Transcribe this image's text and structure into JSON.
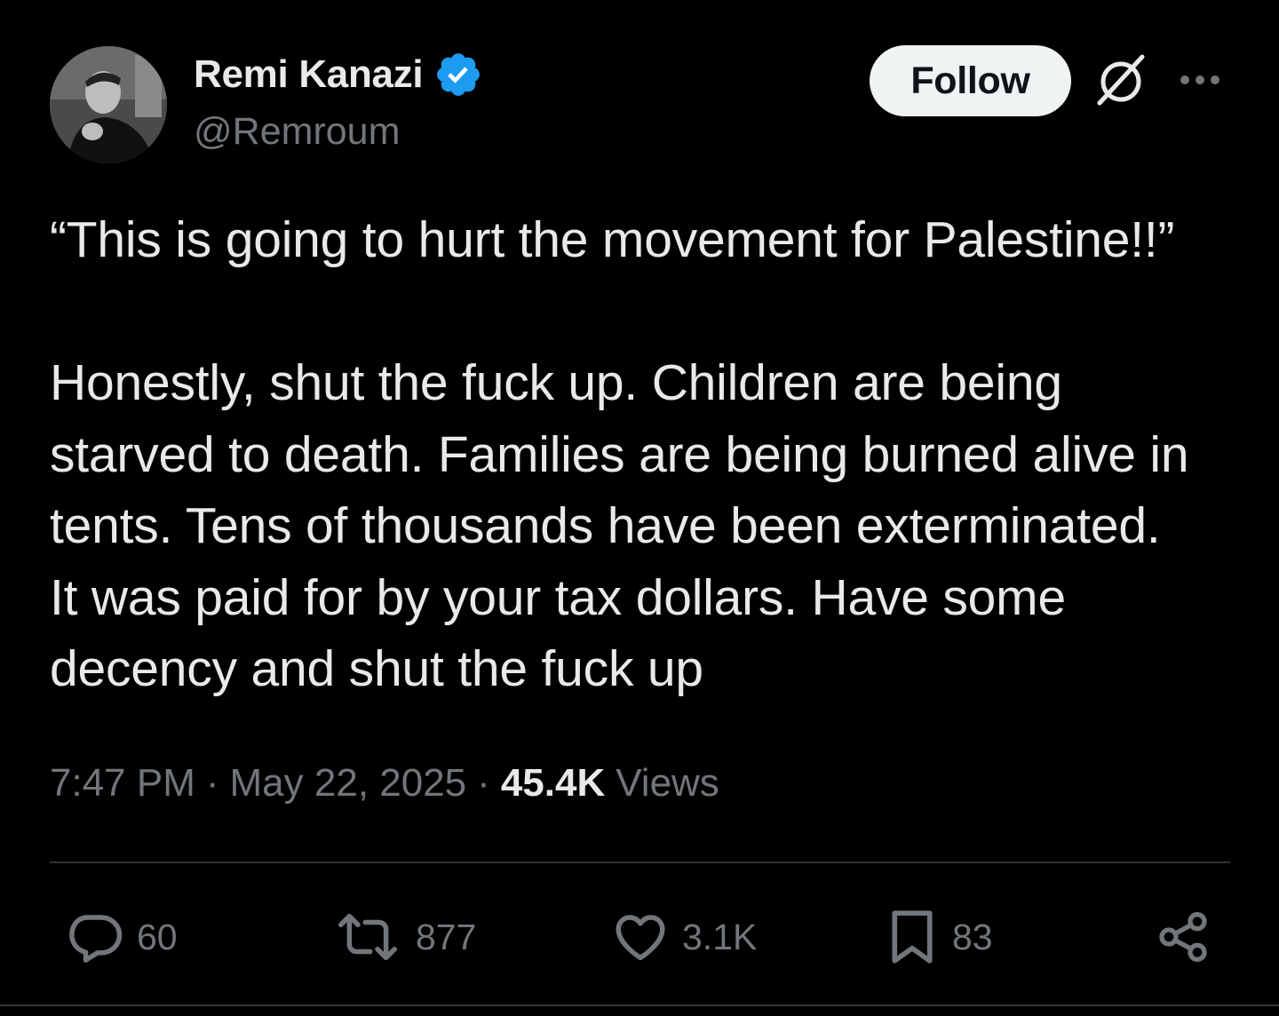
{
  "author": {
    "display_name": "Remi Kanazi",
    "handle": "@Remroum",
    "verified": true,
    "verified_color": "#1d9bf0"
  },
  "header": {
    "follow_label": "Follow"
  },
  "tweet": {
    "text": "“This is going to hurt the movement for Palestine!!”\n\nHonestly, shut the fuck up. Children are being\nstarved to death. Families are being burned alive in\ntents. Tens of thousands have been exterminated.\nIt was paid for by your tax dollars. Have some\ndecency and shut the fuck up",
    "time": "7:47 PM",
    "separator": "·",
    "date": "May 22, 2025",
    "views_count": "45.4K",
    "views_label": "Views"
  },
  "actions": {
    "replies": "60",
    "reposts": "877",
    "likes": "3.1K",
    "bookmarks": "83"
  },
  "colors": {
    "background": "#000000",
    "text_primary": "#e7e9ea",
    "text_secondary": "#71767b",
    "divider": "#2f3336",
    "follow_bg": "#eff3f4"
  }
}
